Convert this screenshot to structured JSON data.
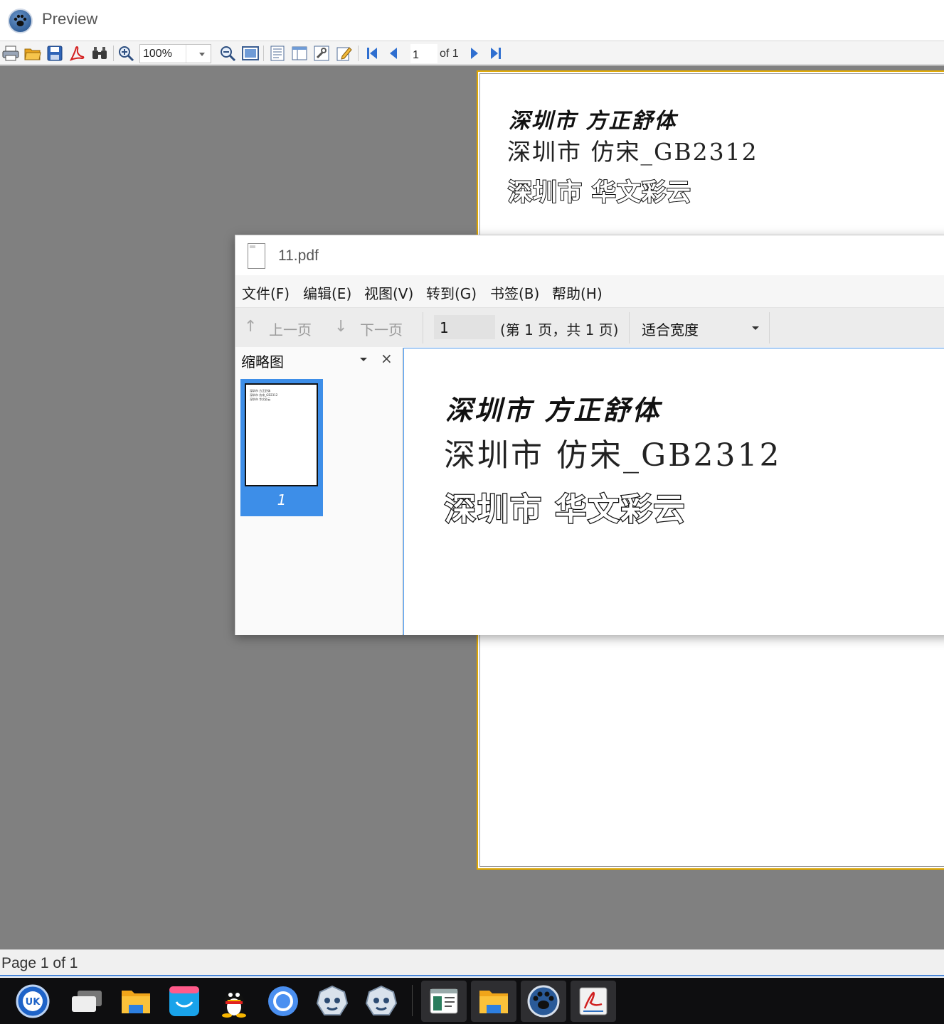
{
  "app": {
    "title": "Preview"
  },
  "toolbar": {
    "buttons": [
      "print-icon",
      "open-icon",
      "save-icon",
      "pdf-export-icon",
      "find-icon",
      "zoom-in-icon",
      "zoom-out-icon",
      "fit-page-icon",
      "page-setup-icon",
      "layout-icon",
      "settings-icon",
      "edit-icon",
      "first-page-icon",
      "prev-page-icon",
      "next-page-icon",
      "last-page-icon"
    ],
    "zoom_value": "100%",
    "page_value": "1",
    "page_of": "of 1"
  },
  "preview_page": {
    "line1": "深圳市 方正舒体",
    "line2": "深圳市  仿宋_GB2312",
    "line3": "深圳市 华文彩云"
  },
  "statusbar": {
    "text": "Page 1 of 1"
  },
  "pdf_window": {
    "title": "11.pdf",
    "menu": [
      "文件(F)",
      "编辑(E)",
      "视图(V)",
      "转到(G)",
      "书签(B)",
      "帮助(H)"
    ],
    "toolbar": {
      "prev_label": "上一页",
      "next_label": "下一页",
      "page_value": "1",
      "page_count": "(第 1 页，共 1 页)",
      "zoom_mode": "适合宽度"
    },
    "thumbnails": {
      "title": "缩略图",
      "close_glyph": "×",
      "pages": [
        "1"
      ]
    },
    "content": {
      "line1": "深圳市 方正舒体",
      "line2": "深圳市  仿宋_GB2312",
      "line3": "深圳市  华文彩云"
    }
  },
  "taskbar": {
    "items": [
      "start-menu-icon",
      "multitask-view-icon",
      "file-manager-icon",
      "app-store-icon",
      "qq-icon",
      "browser-icon",
      "wps-icon",
      "wps-icon-2",
      "system-monitor-icon",
      "file-manager-window-icon",
      "preview-app-icon",
      "pdf-reader-icon"
    ]
  },
  "colors": {
    "canvas": "#808080",
    "accent": "#3d8ee8",
    "page_border": "#e0a800",
    "taskbar": "#0e0e10"
  }
}
